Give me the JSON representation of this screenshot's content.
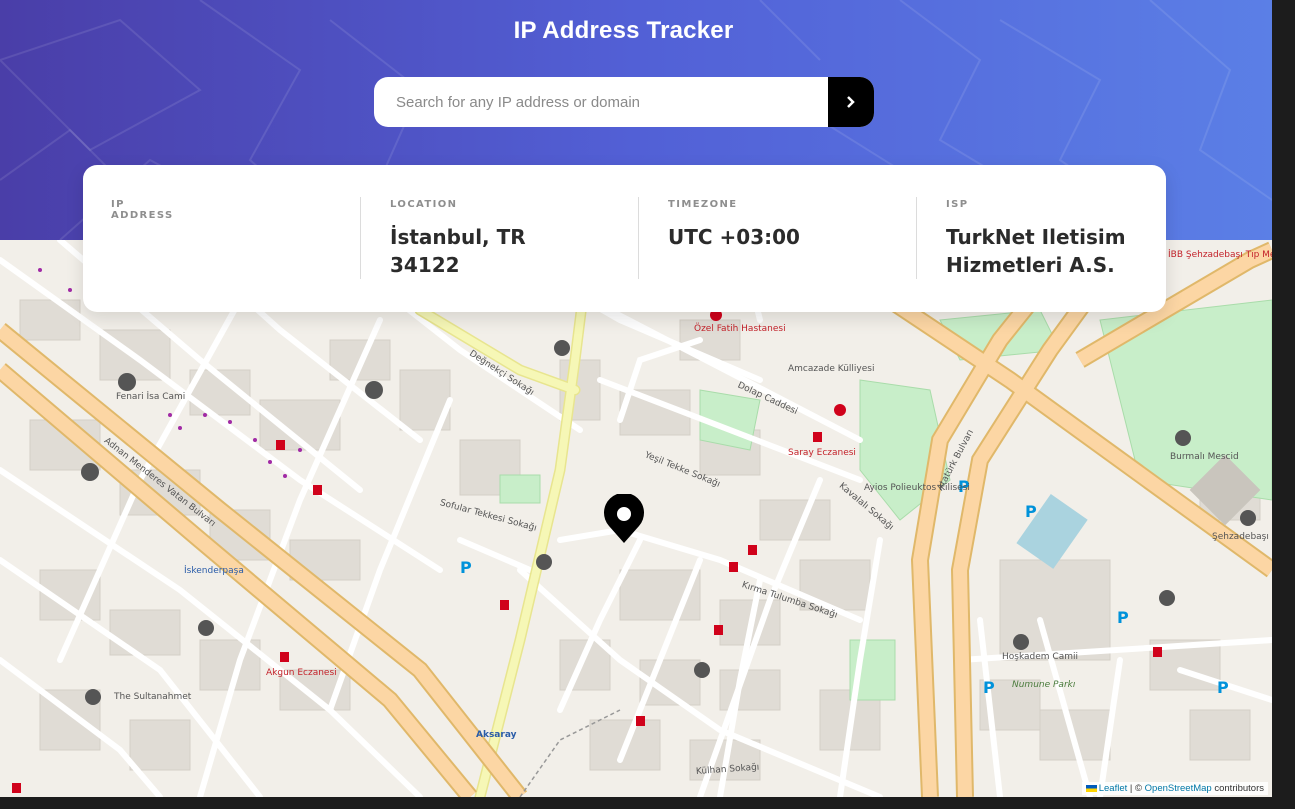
{
  "header": {
    "title": "IP Address Tracker"
  },
  "search": {
    "placeholder": "Search for any IP address or domain",
    "value": "",
    "submit_icon": "chevron-right-icon"
  },
  "info": {
    "ip": {
      "label": "IP ADDRESS",
      "value": ""
    },
    "location": {
      "label": "LOCATION",
      "value_line1": "İstanbul, TR",
      "value_line2": "34122"
    },
    "timezone": {
      "label": "TIMEZONE",
      "value": "UTC +03:00"
    },
    "isp": {
      "label": "ISP",
      "value_line1": "TurkNet Iletisim",
      "value_line2": "Hizmetleri A.S."
    }
  },
  "map": {
    "marker_icon": "location-pin-icon",
    "labels": {
      "degnekci": "Değnekçi Sokağı",
      "dolap": "Dolap Caddesi",
      "yesil_tekke": "Yeşil Tekke Sokağı",
      "sofular": "Sofular Tekkesi Sokağı",
      "adnan": "Adnan Menderes Vatan Bulvarı",
      "kirma": "Kırma Tulumba Sokağı",
      "ataturk": "Atatürk Bulvarı",
      "kavalali": "Kavalalı Sokağı",
      "aksaray": "Aksaray",
      "iskenderpasa": "İskenderpaşa",
      "hoskadem": "Hoşkadem Camii",
      "saray_eczanesi": "Saray Eczanesi",
      "burmali": "Burmalı Mescid",
      "kulhan": "Külhan Sokağı",
      "ayios": "Ayios Polieuktos Kilisesi",
      "amcazade": "Amcazade Külliyesi",
      "fenari": "Fenari İsa Cami",
      "akgun": "Akgun Eczanesi",
      "sultanahmet": "The Sultanahmet",
      "ozel_fatih": "Özel Fatih Hastanesi",
      "ibb": "İBB Şehzadebaşı Tıp Merkezi",
      "sehzadebasi": "Şehzadebaşı Camii",
      "numune": "Numune Parkı"
    },
    "attribution": {
      "leaflet": "Leaflet",
      "separator": " | © ",
      "osm": "OpenStreetMap",
      "contributors": " contributors"
    }
  },
  "colors": {
    "header_start": "#4a3ea8",
    "header_end": "#5b7fe6",
    "map_bg": "#f2efe9",
    "road_major": "#f7d9a0",
    "road_secondary": "#f3f5a8",
    "park": "#c8eec9"
  }
}
